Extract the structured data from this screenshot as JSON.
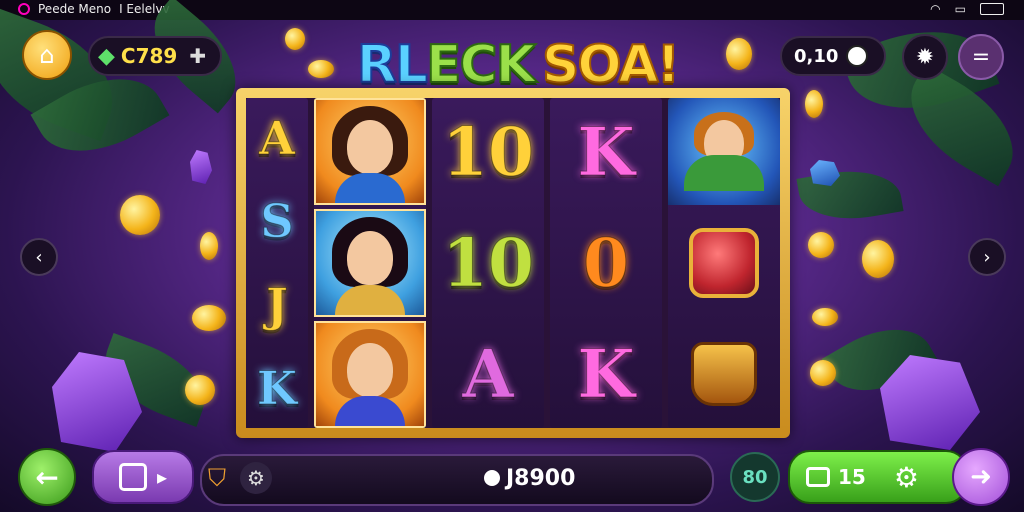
{
  "status_bar": {
    "left_text": "Peede Meno",
    "carrier": "I Eelelvv"
  },
  "title": {
    "part1": "RL",
    "part2": "ECK",
    "part3": "SOA!"
  },
  "top_bar": {
    "gem_balance": "C789",
    "coin_counter": "0,10"
  },
  "reels": [
    [
      {
        "type": "letter",
        "text": "A",
        "color": "#ffd13a"
      },
      {
        "type": "letter",
        "text": "S",
        "color": "#6fc8ff"
      },
      {
        "type": "letter",
        "text": "J",
        "color": "#ffd13a"
      },
      {
        "type": "letter",
        "text": "K",
        "color": "#6fc8ff"
      }
    ],
    [
      {
        "type": "portrait",
        "name": "woman-dark-hair-portrait"
      },
      {
        "type": "portrait",
        "name": "woman-jungle-portrait"
      },
      {
        "type": "portrait",
        "name": "girl-red-hair-portrait"
      }
    ],
    [
      {
        "type": "big",
        "text": "10",
        "color": "#ffd13a"
      },
      {
        "type": "big",
        "text": "10",
        "color": "#c0e040"
      },
      {
        "type": "big",
        "text": "A",
        "color": "#e06adf"
      }
    ],
    [
      {
        "type": "big",
        "text": "K",
        "color": "#ff6ae0"
      },
      {
        "type": "big",
        "text": "0",
        "color": "#ff8a1e"
      },
      {
        "type": "big",
        "text": "K",
        "color": "#ff6ae0"
      }
    ],
    [
      {
        "type": "hero",
        "name": "hero-boy-symbol"
      },
      {
        "type": "gem",
        "name": "red-gem-chest-symbol"
      },
      {
        "type": "pot",
        "name": "gold-pot-symbol"
      }
    ]
  ],
  "bottom_bar": {
    "balance": "J8900",
    "bet_value": "80",
    "lines_label": "15"
  },
  "colors": {
    "accent_green": "#58c43a",
    "accent_purple": "#9a4fd6",
    "gold": "#f4b41a"
  }
}
